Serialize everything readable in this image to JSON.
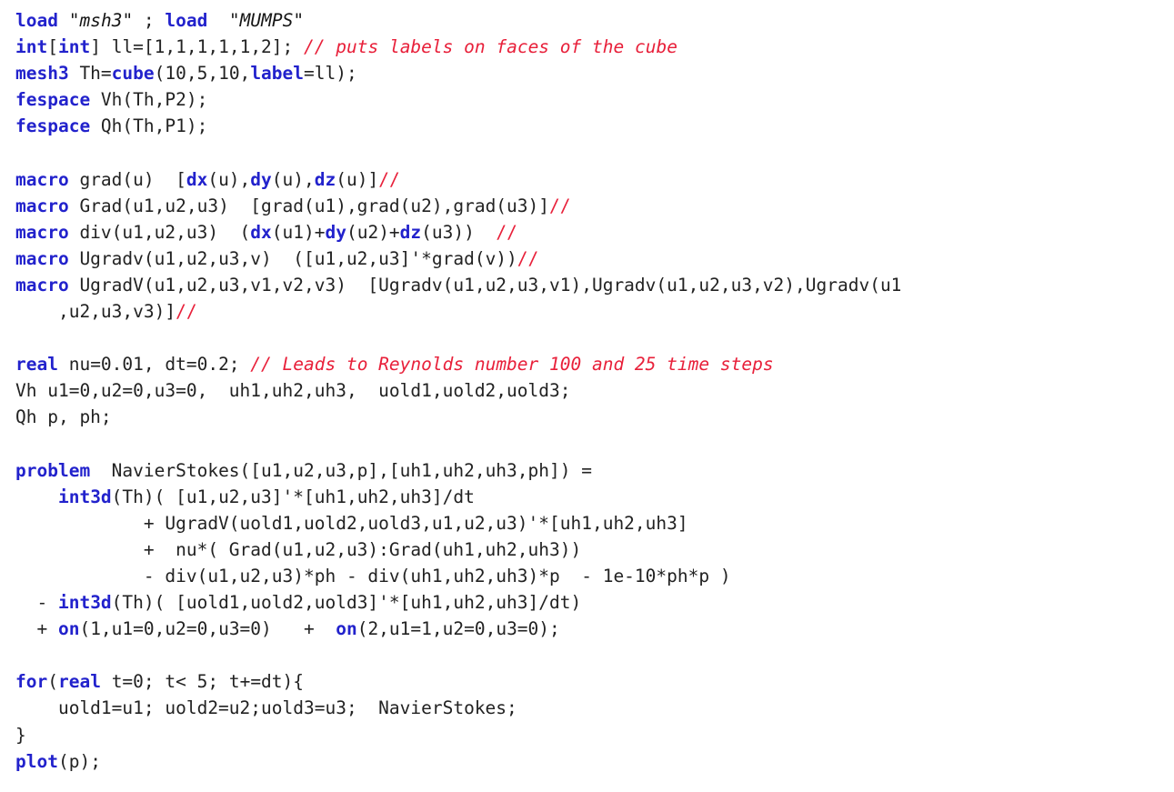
{
  "document": {
    "kind": "source-code-listing",
    "language": "FreeFEM (EDP)",
    "background_color": "#ffffff",
    "colors": {
      "keyword": "#2222cc",
      "comment": "#e8203a",
      "plain": "#222222",
      "string": "#151515"
    }
  },
  "code": {
    "plain_text": "load \"msh3\" ; load \"MUMPS\"\nint[int] ll=[1,1,1,1,1,2]; // puts labels on faces of the cube\nmesh3 Th=cube(10,5,10,label=ll);\nfespace Vh(Th,P2);\nfespace Qh(Th,P1);\n\nmacro grad(u)  [dx(u),dy(u),dz(u)]//\nmacro Grad(u1,u2,u3)  [grad(u1),grad(u2),grad(u3)]//\nmacro div(u1,u2,u3)  (dx(u1)+dy(u2)+dz(u3))  //\nmacro Ugradv(u1,u2,u3,v)  ([u1,u2,u3]'*grad(v))//\nmacro UgradV(u1,u2,u3,v1,v2,v3)  [Ugradv(u1,u2,u3,v1),Ugradv(u1,u2,u3,v2),Ugradv(u1\n    ,u2,u3,v3)]//\n\nreal nu=0.01, dt=0.2; // Leads to Reynolds number 100 and 25 time steps\nVh u1=0,u2=0,u3=0,  uh1,uh2,uh3,  uold1,uold2,uold3;\nQh p, ph;\n\nproblem  NavierStokes([u1,u2,u3,p],[uh1,uh2,uh3,ph]) =\n    int3d(Th)( [u1,u2,u3]'*[uh1,uh2,uh3]/dt\n            + UgradV(uold1,uold2,uold3,u1,u2,u3)'*[uh1,uh2,uh3]\n            +  nu*( Grad(u1,u2,u3):Grad(uh1,uh2,uh3))\n            - div(u1,u2,u3)*ph - div(uh1,uh2,uh3)*p  - 1e-10*ph*p )\n  - int3d(Th)( [uold1,uold2,uold3]'*[uh1,uh2,uh3]/dt)\n  + on(1,u1=0,u2=0,u3=0)   +  on(2,u1=1,u2=0,u3=0);\n\nfor(real t=0; t< 5; t+=dt){\n    uold1=u1; uold2=u2;uold3=u3;  NavierStokes;\n}\nplot(p);",
    "lines": [
      {
        "index": 1,
        "tokens": [
          {
            "t": "kw",
            "v": "load"
          },
          {
            "t": "plain",
            "v": " "
          },
          {
            "t": "quote",
            "v": "\""
          },
          {
            "t": "str",
            "v": "msh3"
          },
          {
            "t": "quote",
            "v": "\""
          },
          {
            "t": "plain",
            "v": " ; "
          },
          {
            "t": "kw",
            "v": "load"
          },
          {
            "t": "plain",
            "v": "  "
          },
          {
            "t": "quote",
            "v": "\""
          },
          {
            "t": "str",
            "v": "MUMPS"
          },
          {
            "t": "quote",
            "v": "\""
          }
        ]
      },
      {
        "index": 2,
        "tokens": [
          {
            "t": "kw",
            "v": "int"
          },
          {
            "t": "plain",
            "v": "["
          },
          {
            "t": "kw",
            "v": "int"
          },
          {
            "t": "plain",
            "v": "] ll=[1,1,1,1,1,2]; "
          },
          {
            "t": "cmt",
            "v": "// puts labels on faces of the cube"
          }
        ]
      },
      {
        "index": 3,
        "tokens": [
          {
            "t": "kw",
            "v": "mesh3"
          },
          {
            "t": "plain",
            "v": " Th="
          },
          {
            "t": "kw",
            "v": "cube"
          },
          {
            "t": "plain",
            "v": "(10,5,10,"
          },
          {
            "t": "kw",
            "v": "label"
          },
          {
            "t": "plain",
            "v": "=ll);"
          }
        ]
      },
      {
        "index": 4,
        "tokens": [
          {
            "t": "kw",
            "v": "fespace"
          },
          {
            "t": "plain",
            "v": " Vh(Th,P2);"
          }
        ]
      },
      {
        "index": 5,
        "tokens": [
          {
            "t": "kw",
            "v": "fespace"
          },
          {
            "t": "plain",
            "v": " Qh(Th,P1);"
          }
        ]
      },
      {
        "index": 6,
        "tokens": []
      },
      {
        "index": 7,
        "tokens": [
          {
            "t": "kw",
            "v": "macro"
          },
          {
            "t": "plain",
            "v": " grad(u)  ["
          },
          {
            "t": "kw",
            "v": "dx"
          },
          {
            "t": "plain",
            "v": "(u),"
          },
          {
            "t": "kw",
            "v": "dy"
          },
          {
            "t": "plain",
            "v": "(u),"
          },
          {
            "t": "kw",
            "v": "dz"
          },
          {
            "t": "plain",
            "v": "(u)]"
          },
          {
            "t": "slash",
            "v": "//"
          }
        ]
      },
      {
        "index": 8,
        "tokens": [
          {
            "t": "kw",
            "v": "macro"
          },
          {
            "t": "plain",
            "v": " Grad(u1,u2,u3)  [grad(u1),grad(u2),grad(u3)]"
          },
          {
            "t": "slash",
            "v": "//"
          }
        ]
      },
      {
        "index": 9,
        "tokens": [
          {
            "t": "kw",
            "v": "macro"
          },
          {
            "t": "plain",
            "v": " div(u1,u2,u3)  ("
          },
          {
            "t": "kw",
            "v": "dx"
          },
          {
            "t": "plain",
            "v": "(u1)+"
          },
          {
            "t": "kw",
            "v": "dy"
          },
          {
            "t": "plain",
            "v": "(u2)+"
          },
          {
            "t": "kw",
            "v": "dz"
          },
          {
            "t": "plain",
            "v": "(u3))  "
          },
          {
            "t": "slash",
            "v": "//"
          }
        ]
      },
      {
        "index": 10,
        "tokens": [
          {
            "t": "kw",
            "v": "macro"
          },
          {
            "t": "plain",
            "v": " Ugradv(u1,u2,u3,v)  ([u1,u2,u3]'*grad(v))"
          },
          {
            "t": "slash",
            "v": "//"
          }
        ]
      },
      {
        "index": 11,
        "tokens": [
          {
            "t": "kw",
            "v": "macro"
          },
          {
            "t": "plain",
            "v": " UgradV(u1,u2,u3,v1,v2,v3)  [Ugradv(u1,u2,u3,v1),Ugradv(u1,u2,u3,v2),Ugradv(u1"
          }
        ]
      },
      {
        "index": 12,
        "tokens": [
          {
            "t": "plain",
            "v": "    ,u2,u3,v3)]"
          },
          {
            "t": "slash",
            "v": "//"
          }
        ]
      },
      {
        "index": 13,
        "tokens": []
      },
      {
        "index": 14,
        "tokens": [
          {
            "t": "kw",
            "v": "real"
          },
          {
            "t": "plain",
            "v": " nu=0.01, dt=0.2; "
          },
          {
            "t": "cmt",
            "v": "// Leads to Reynolds number 100 and 25 time steps"
          }
        ]
      },
      {
        "index": 15,
        "tokens": [
          {
            "t": "plain",
            "v": "Vh u1=0,u2=0,u3=0,  uh1,uh2,uh3,  uold1,uold2,uold3;"
          }
        ]
      },
      {
        "index": 16,
        "tokens": [
          {
            "t": "plain",
            "v": "Qh p, ph;"
          }
        ]
      },
      {
        "index": 17,
        "tokens": []
      },
      {
        "index": 18,
        "tokens": [
          {
            "t": "kw",
            "v": "problem"
          },
          {
            "t": "plain",
            "v": "  NavierStokes([u1,u2,u3,p],[uh1,uh2,uh3,ph]) ="
          }
        ]
      },
      {
        "index": 19,
        "tokens": [
          {
            "t": "plain",
            "v": "    "
          },
          {
            "t": "kw",
            "v": "int3d"
          },
          {
            "t": "plain",
            "v": "(Th)( [u1,u2,u3]'*[uh1,uh2,uh3]/dt"
          }
        ]
      },
      {
        "index": 20,
        "tokens": [
          {
            "t": "plain",
            "v": "            + UgradV(uold1,uold2,uold3,u1,u2,u3)'*[uh1,uh2,uh3]"
          }
        ]
      },
      {
        "index": 21,
        "tokens": [
          {
            "t": "plain",
            "v": "            +  nu*( Grad(u1,u2,u3):Grad(uh1,uh2,uh3))"
          }
        ]
      },
      {
        "index": 22,
        "tokens": [
          {
            "t": "plain",
            "v": "            - div(u1,u2,u3)*ph - div(uh1,uh2,uh3)*p  - 1e-10*ph*p )"
          }
        ]
      },
      {
        "index": 23,
        "tokens": [
          {
            "t": "plain",
            "v": "  - "
          },
          {
            "t": "kw",
            "v": "int3d"
          },
          {
            "t": "plain",
            "v": "(Th)( [uold1,uold2,uold3]'*[uh1,uh2,uh3]/dt)"
          }
        ]
      },
      {
        "index": 24,
        "tokens": [
          {
            "t": "plain",
            "v": "  + "
          },
          {
            "t": "kw",
            "v": "on"
          },
          {
            "t": "plain",
            "v": "(1,u1=0,u2=0,u3=0)   +  "
          },
          {
            "t": "kw",
            "v": "on"
          },
          {
            "t": "plain",
            "v": "(2,u1=1,u2=0,u3=0);"
          }
        ]
      },
      {
        "index": 25,
        "tokens": []
      },
      {
        "index": 26,
        "tokens": [
          {
            "t": "kw",
            "v": "for"
          },
          {
            "t": "plain",
            "v": "("
          },
          {
            "t": "kw",
            "v": "real"
          },
          {
            "t": "plain",
            "v": " t=0; t< 5; t+=dt){"
          }
        ]
      },
      {
        "index": 27,
        "tokens": [
          {
            "t": "plain",
            "v": "    uold1=u1; uold2=u2;uold3=u3;  NavierStokes;"
          }
        ]
      },
      {
        "index": 28,
        "tokens": [
          {
            "t": "plain",
            "v": "}"
          }
        ]
      },
      {
        "index": 29,
        "tokens": [
          {
            "t": "kw",
            "v": "plot"
          },
          {
            "t": "plain",
            "v": "(p);"
          }
        ]
      }
    ]
  }
}
